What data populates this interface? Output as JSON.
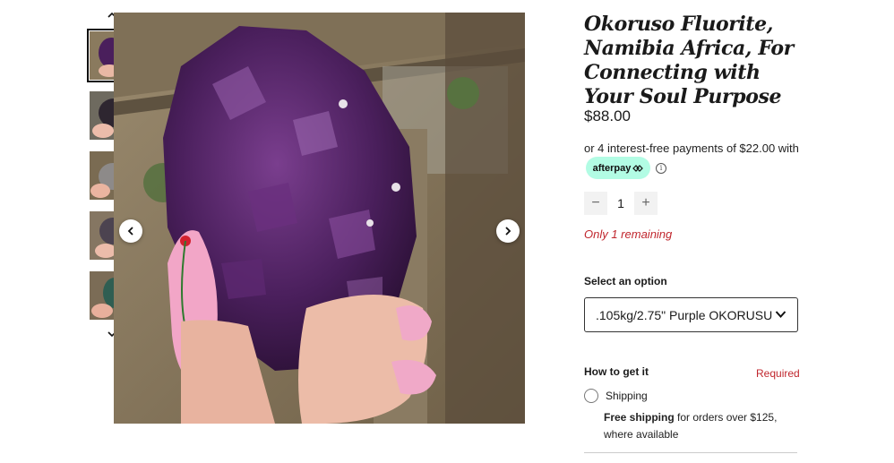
{
  "product": {
    "title": "Okoruso Fluorite, Namibia Africa, For Connecting with Your Soul Purpose",
    "price": "$88.00",
    "installments_text": "or 4 interest-free payments of $22.00 with",
    "afterpay_label": "afterpay",
    "quantity": "1",
    "stock_note": "Only 1 remaining"
  },
  "options": {
    "label": "Select an option",
    "selected": ".105kg/2.75\" Purple OKORUSU ..."
  },
  "fulfillment": {
    "heading": "How to get it",
    "required_label": "Required",
    "shipping_label": "Shipping",
    "free_shipping_bold": "Free shipping",
    "free_shipping_rest": " for orders over $125, where available"
  },
  "icons": {
    "thumb_up": "chevron-up-icon",
    "thumb_down": "chevron-down-icon",
    "prev": "chevron-left-icon",
    "next": "chevron-right-icon",
    "afterpay": "afterpay-logo-icon",
    "info": "info-icon",
    "minus": "minus-icon",
    "plus": "plus-icon",
    "select": "chevron-down-icon"
  },
  "colors": {
    "accent_red": "#c0262d",
    "afterpay_mint": "#b2fce4",
    "crystal_purple": "#4a1f5c"
  }
}
